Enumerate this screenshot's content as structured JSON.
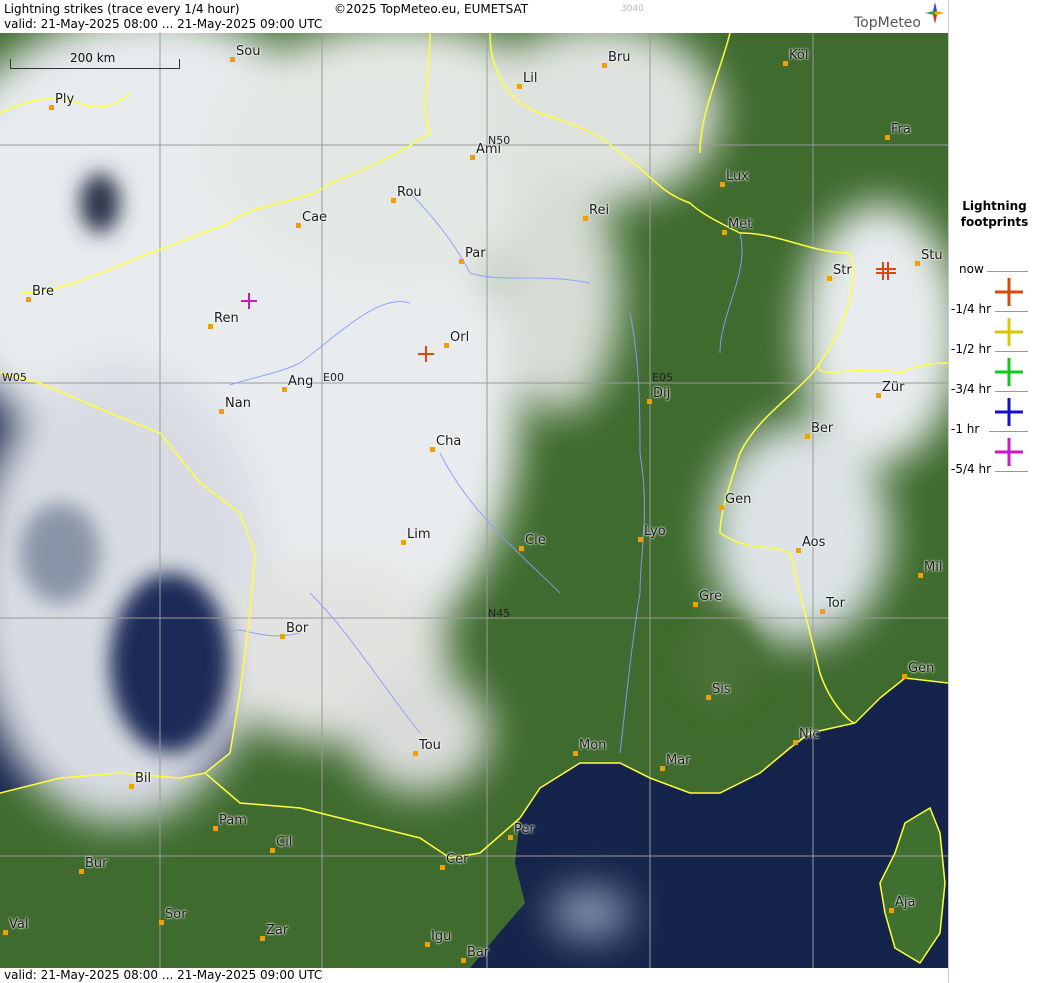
{
  "header": {
    "title": "Lightning strikes (trace every 1/4 hour)",
    "copyright": "©2025 TopMeteo.eu, EUMETSAT",
    "code": "3040",
    "validity": "valid:  21-May-2025 08:00 ... 21-May-2025 09:00 UTC",
    "brand": "TopMeteo"
  },
  "footer": {
    "validity": "valid:  21-May-2025 08:00 ... 21-May-2025 09:00 UTC"
  },
  "scale": {
    "label": "200 km"
  },
  "grid_labels": [
    "N50",
    "N45",
    "W05",
    "E00",
    "E05"
  ],
  "cities": [
    "Sou",
    "Ply",
    "Lil",
    "Bru",
    "Köl",
    "Ami",
    "Fra",
    "Rou",
    "Lux",
    "Cae",
    "Rei",
    "Met",
    "Par",
    "Stu",
    "Str",
    "Bre",
    "Ren",
    "Orl",
    "Ang",
    "Dij",
    "Nan",
    "Zür",
    "Ber",
    "Cha",
    "Gen",
    "Lim",
    "Cle",
    "Lyo",
    "Aos",
    "Mil",
    "Gre",
    "Tor",
    "Bor",
    "Sis",
    "Gen",
    "Tou",
    "Mon",
    "Nic",
    "Mar",
    "Bil",
    "Pam",
    "Cil",
    "Per",
    "Cer",
    "Bur",
    "Sor",
    "Val",
    "Zar",
    "Igu",
    "Bar",
    "Aja"
  ],
  "legend": {
    "title_line1": "Lightning",
    "title_line2": "footprints",
    "items": [
      {
        "label": "now",
        "color": ""
      },
      {
        "label": "-1/4 hr",
        "color": "#d84a0c"
      },
      {
        "label": "-1/2 hr",
        "color": "#d8c800"
      },
      {
        "label": "-3/4 hr",
        "color": "#10c818"
      },
      {
        "label": "-1 hr",
        "color": "#1010c8"
      },
      {
        "label": "-5/4 hr",
        "color": "#c818c8"
      }
    ]
  },
  "colors": {
    "border_yellow": "#ffff3c",
    "river_blue": "#8c9cff",
    "grid_gray": "#9a9a9a",
    "city_dot": "#f0a000",
    "sea_dark": "#0c1838",
    "land_green": "#3a6a2a",
    "cloud_white": "#e8ecee"
  }
}
